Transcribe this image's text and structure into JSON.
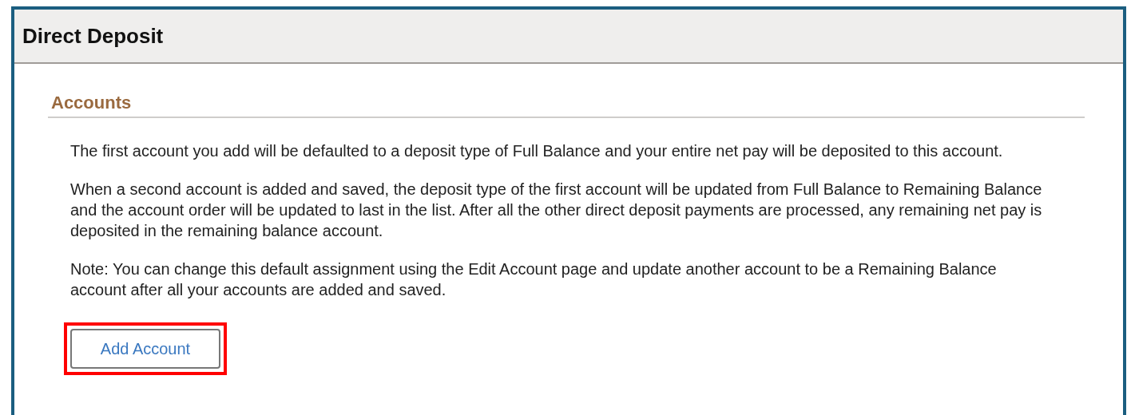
{
  "window": {
    "title": "Direct Deposit"
  },
  "section": {
    "title": "Accounts",
    "paragraphs": [
      "The first account you add will be defaulted to a deposit type of Full Balance and your entire net pay will be deposited to this account.",
      "When a second account is added and saved, the deposit type of the first account will be updated from Full Balance to Remaining Balance and the account order will be updated to last in the list. After all the other direct deposit payments are processed, any remaining net pay is deposited in the remaining balance account.",
      "Note: You can change this default assignment using the Edit Account page and update another account to be a Remaining Balance account after all your accounts are added and saved."
    ],
    "button": {
      "label": "Add Account",
      "highlighted": true
    }
  }
}
